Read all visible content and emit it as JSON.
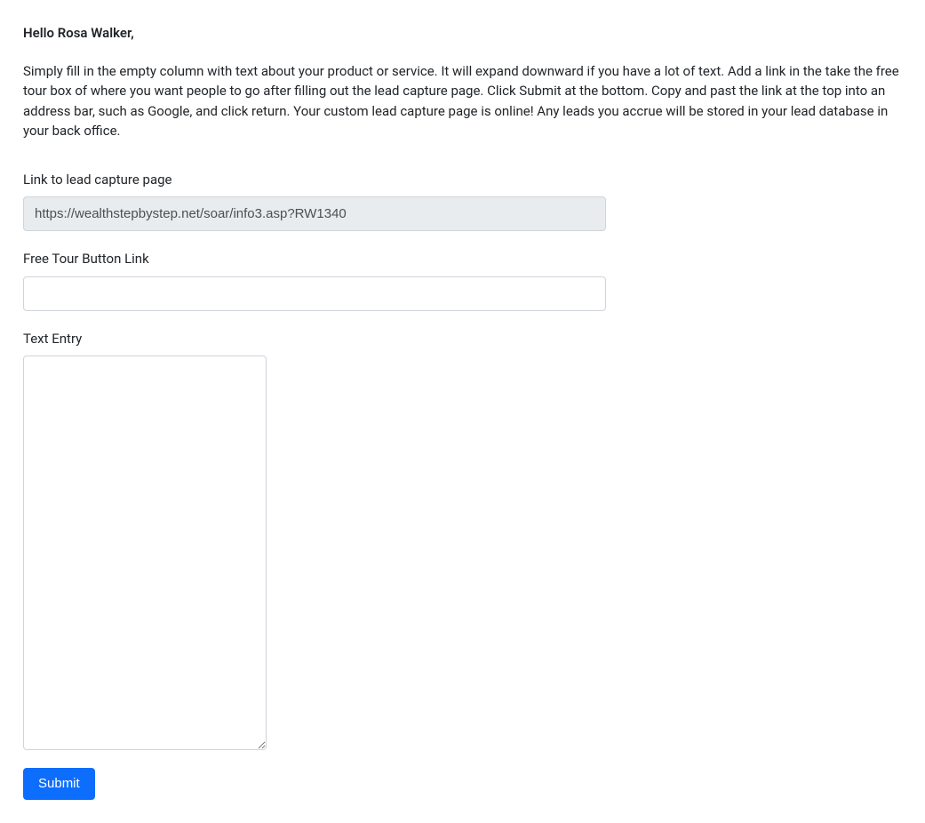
{
  "greeting": "Hello Rosa Walker,",
  "intro": "Simply fill in the empty column with text about your product or service. It will expand downward if you have a lot of text. Add a link in the take the free tour box of where you want people to go after filling out the lead capture page. Click Submit at the bottom. Copy and past the link at the top into an address bar, such as Google, and click return. Your custom lead capture page is online! Any leads you accrue will be stored in your lead database in your back office.",
  "form": {
    "link_label": "Link to lead capture page",
    "link_value": "https://wealthstepbystep.net/soar/info3.asp?RW1340",
    "tour_label": "Free Tour Button Link",
    "tour_value": "",
    "text_label": "Text Entry",
    "text_value": "",
    "submit_label": "Submit"
  }
}
